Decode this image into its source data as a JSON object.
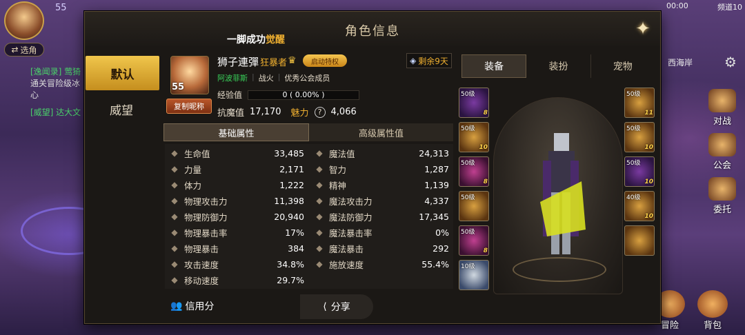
{
  "hud": {
    "level": "55",
    "switch_label": "选角",
    "chat_line1": "[逸闻录] 莺猗",
    "chat_line2": "通关冒险级冰心",
    "chat_line3": "[威望] 达大文",
    "time": "00:00",
    "channel": "频道10",
    "location": "西海岸",
    "side_buttons": [
      "对战",
      "公会",
      "委托"
    ],
    "bottom_buttons": [
      "冒险",
      "背包"
    ]
  },
  "panel": {
    "title": "角色信息",
    "banner_prefix": "一脚成功",
    "banner_highlight": "觉醒",
    "side_tabs": [
      "默认",
      "威望"
    ]
  },
  "character": {
    "level": "55",
    "copy_button": "复制昵称",
    "name": "狮子連彈",
    "class": "狂暴者",
    "privilege_button": "启动特权",
    "server_tag": "阿波菲斯",
    "guild": "战火",
    "guild_role": "优秀公会成员",
    "remaining": "剩余9天",
    "exp_label": "经验值",
    "exp_value": "0 ( 0.00% )",
    "exp_progress": 0,
    "anti_magic_label": "抗魔值",
    "anti_magic_value": "17,170",
    "charm_label": "魅力",
    "charm_value": "4,066"
  },
  "attr_tabs": [
    "基础属性",
    "高级属性值"
  ],
  "attributes": {
    "left": [
      {
        "icon": "heart-icon",
        "name": "生命值",
        "value": "33,485"
      },
      {
        "icon": "fist-icon",
        "name": "力量",
        "value": "2,171"
      },
      {
        "icon": "body-icon",
        "name": "体力",
        "value": "1,222"
      },
      {
        "icon": "sword-icon",
        "name": "物理攻击力",
        "value": "11,398"
      },
      {
        "icon": "shield-icon",
        "name": "物理防御力",
        "value": "20,940"
      },
      {
        "icon": "crit-icon",
        "name": "物理暴击率",
        "value": "17%"
      },
      {
        "icon": "crit-dmg-icon",
        "name": "物理暴击",
        "value": "384"
      },
      {
        "icon": "attack-speed-icon",
        "name": "攻击速度",
        "value": "34.8%"
      },
      {
        "icon": "move-speed-icon",
        "name": "移动速度",
        "value": "29.7%"
      }
    ],
    "right": [
      {
        "icon": "mana-heart-icon",
        "name": "魔法值",
        "value": "24,313"
      },
      {
        "icon": "intellect-icon",
        "name": "智力",
        "value": "1,287"
      },
      {
        "icon": "spirit-icon",
        "name": "精神",
        "value": "1,139"
      },
      {
        "icon": "magic-attack-icon",
        "name": "魔法攻击力",
        "value": "4,337"
      },
      {
        "icon": "magic-defense-icon",
        "name": "魔法防御力",
        "value": "17,345"
      },
      {
        "icon": "magic-crit-icon",
        "name": "魔法暴击率",
        "value": "0%"
      },
      {
        "icon": "magic-crit-dmg-icon",
        "name": "魔法暴击",
        "value": "292"
      },
      {
        "icon": "cast-speed-icon",
        "name": "施放速度",
        "value": "55.4%"
      }
    ]
  },
  "buttons": {
    "credit": "信用分",
    "share": "分享"
  },
  "equip_tabs": [
    "装备",
    "装扮",
    "宠物"
  ],
  "equip_left": [
    {
      "level": "50级",
      "badge": "8"
    },
    {
      "level": "50级",
      "badge": "10"
    },
    {
      "level": "50级",
      "badge": "8"
    },
    {
      "level": "50级",
      "badge": ""
    },
    {
      "level": "50级",
      "badge": "8"
    },
    {
      "level": "10级",
      "badge": ""
    }
  ],
  "equip_right": [
    {
      "level": "50级",
      "badge": "11"
    },
    {
      "level": "50级",
      "badge": "10"
    },
    {
      "level": "50级",
      "badge": "10"
    },
    {
      "level": "40级",
      "badge": "10"
    },
    {
      "level": "",
      "badge": ""
    }
  ]
}
